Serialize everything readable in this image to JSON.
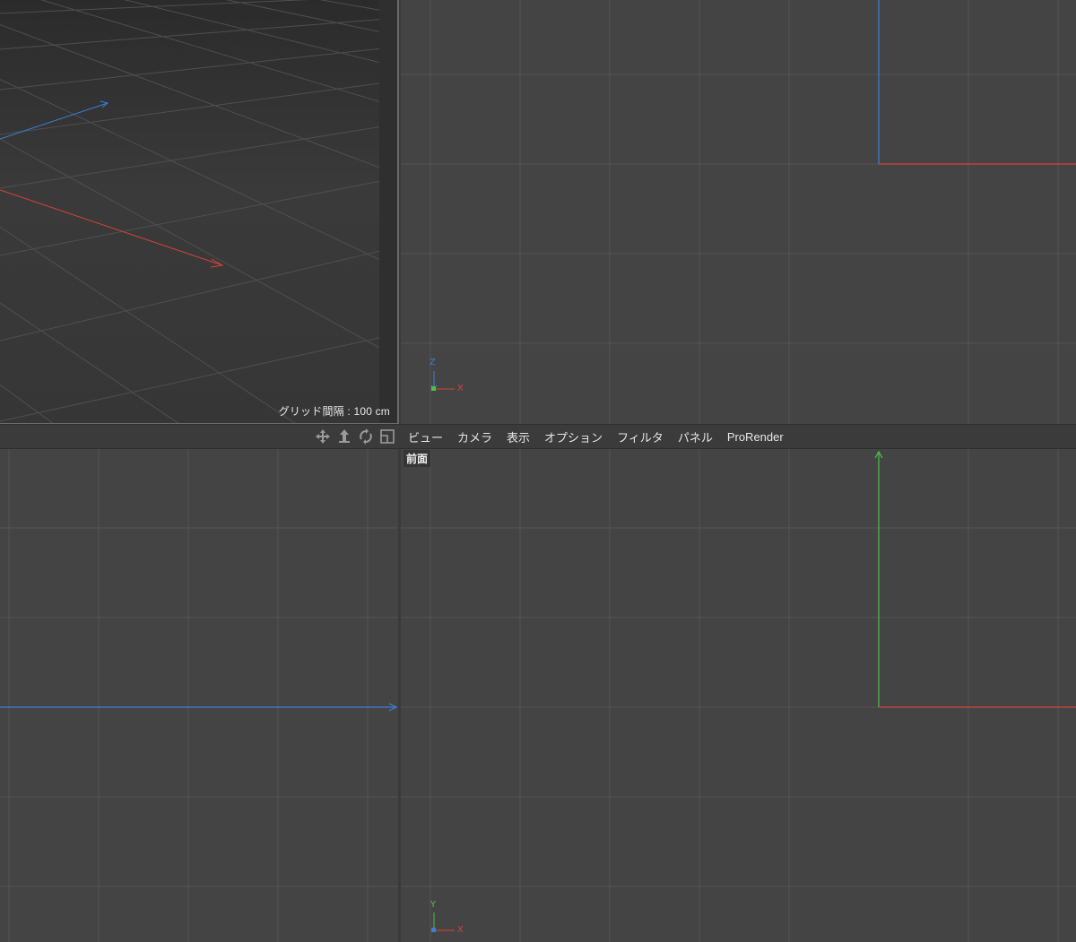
{
  "perspective_view": {
    "grid_label": "グリッド間隔 : 100 cm"
  },
  "toolbar": {
    "nav_icons": [
      {
        "name": "move-view-icon"
      },
      {
        "name": "dolly-view-icon"
      },
      {
        "name": "rotate-view-icon"
      },
      {
        "name": "toggle-view-icon"
      }
    ],
    "menu": [
      {
        "label": "ビュー"
      },
      {
        "label": "カメラ"
      },
      {
        "label": "表示"
      },
      {
        "label": "オプション"
      },
      {
        "label": "フィルタ"
      },
      {
        "label": "パネル"
      },
      {
        "label": "ProRender"
      }
    ]
  },
  "front_view": {
    "title": "前面"
  },
  "axis_gizmos": {
    "top_view": {
      "up": "Z",
      "right": "X"
    },
    "front_view": {
      "up": "Y",
      "right": "X"
    }
  },
  "colors": {
    "x_axis": "#d8423c",
    "y_axis": "#4bc14b",
    "z_axis": "#3a7fd6",
    "grid_line": "#555555",
    "viewport_bg": "#444444"
  }
}
